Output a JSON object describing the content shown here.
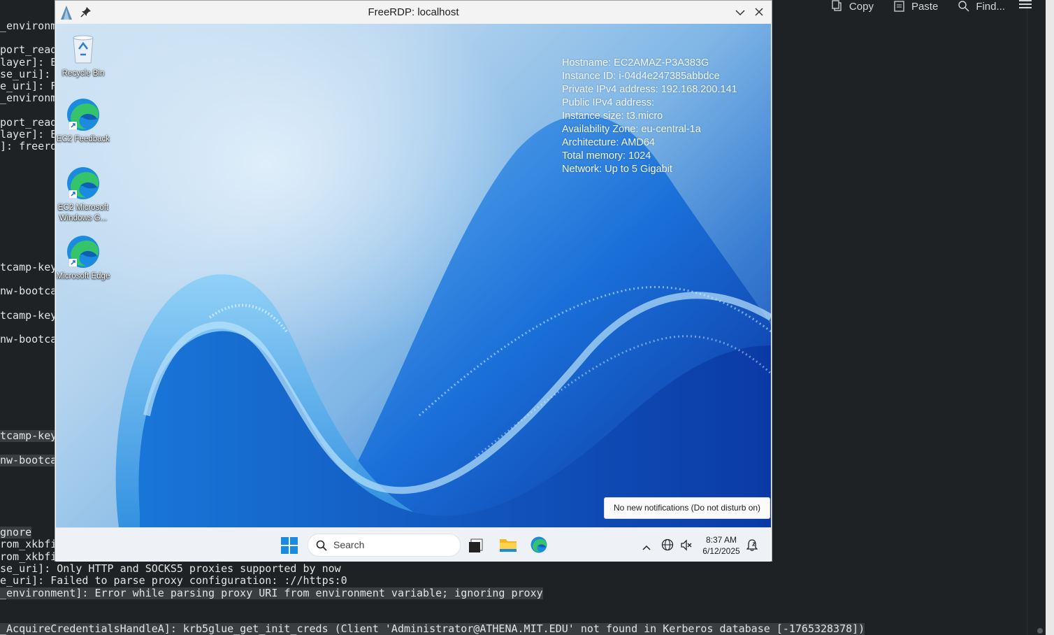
{
  "terminal": {
    "toolbar": {
      "copy": "Copy",
      "paste": "Paste",
      "find": "Find..."
    },
    "lines": [
      {
        "text": "_environm",
        "highlight": false
      },
      {
        "text": "port_read",
        "highlight": false
      },
      {
        "text": "layer]: E",
        "highlight": false
      },
      {
        "text": "se_uri]: ",
        "highlight": false
      },
      {
        "text": "e_uri]: F",
        "highlight": false
      },
      {
        "text": "_environm",
        "highlight": false
      },
      {
        "text": "port_read",
        "highlight": false
      },
      {
        "text": "layer]: E",
        "highlight": false
      },
      {
        "text": "]: freerd",
        "highlight": false
      },
      {
        "text": "tcamp-key",
        "highlight": false
      },
      {
        "text": "nw-bootca",
        "highlight": false
      },
      {
        "text": "tcamp-key",
        "highlight": false
      },
      {
        "text": "nw-bootca",
        "highlight": false
      },
      {
        "text": "tcamp-key",
        "highlight": true
      },
      {
        "text": "nw-bootca",
        "highlight": true
      },
      {
        "text": "gnore",
        "highlight": true
      },
      {
        "text": "rom_xkbfi",
        "highlight": false
      },
      {
        "text": "rom_xkbfi",
        "highlight": false
      },
      {
        "text": "se_uri]: Only HTTP and SOCKS5 proxies supported by now",
        "highlight": false
      },
      {
        "text": "e_uri]: Failed to parse proxy configuration: ://https:0",
        "highlight": false
      },
      {
        "text": "_environment]: Error while parsing proxy URI from environment variable; ignoring proxy",
        "highlight": true
      },
      {
        "text": "_AcquireCredentialsHandleA]: krb5glue_get_init_creds (Client 'Administrator@ATHENA.MIT.EDU' not found in Kerberos database [-1765328378])",
        "highlight": true
      }
    ]
  },
  "window": {
    "title": "FreeRDP: localhost"
  },
  "desktop": {
    "icons": [
      {
        "label": "Recycle Bin",
        "icon": "recycle-bin-icon"
      },
      {
        "label": "EC2 Feedback",
        "icon": "edge-icon"
      },
      {
        "label": "EC2 Microsoft Windows G...",
        "icon": "edge-icon"
      },
      {
        "label": "Microsoft Edge",
        "icon": "edge-icon"
      }
    ],
    "sysinfo": [
      "Hostname: EC2AMAZ-P3A383G",
      "Instance ID: i-04d4e247385abbdce",
      "Private IPv4 address: 192.168.200.141",
      "Public IPv4 address:",
      "Instance size: t3.micro",
      "Availability Zone: eu-central-1a",
      "Architecture: AMD64",
      "Total memory: 1024",
      "Network: Up to 5 Gigabit"
    ],
    "notification": "No new notifications (Do not disturb on)"
  },
  "taskbar": {
    "search_placeholder": "Search",
    "time": "8:37 AM",
    "date": "6/12/2025"
  }
}
